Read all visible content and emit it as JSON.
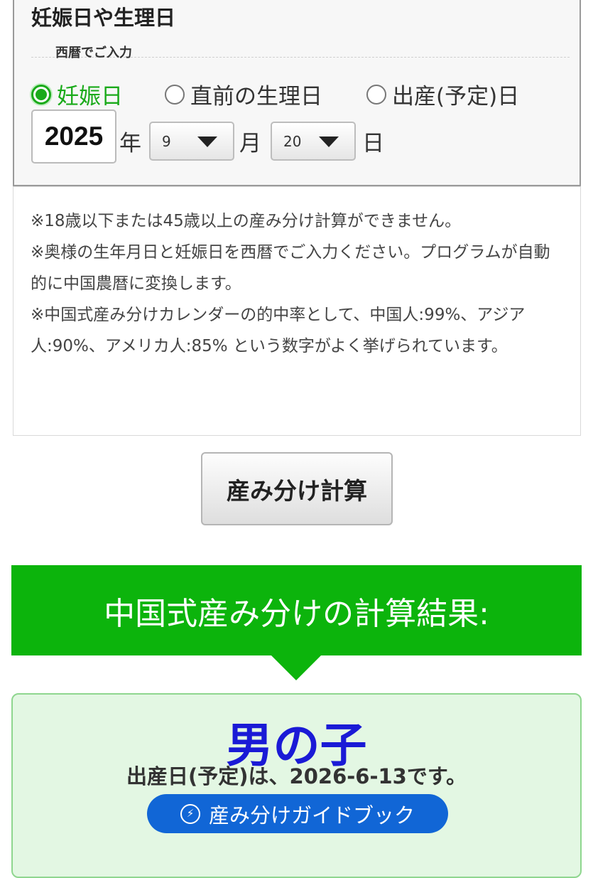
{
  "date_panel": {
    "title": "妊娠日や生理日",
    "era_label": "西暦でご入力",
    "radios": [
      {
        "label": "妊娠日",
        "checked": true
      },
      {
        "label": "直前の生理日",
        "checked": false
      },
      {
        "label": "出産(予定)日",
        "checked": false
      }
    ],
    "year_value": "2025",
    "year_unit": "年",
    "month_value": "9",
    "month_unit": "月",
    "day_value": "20",
    "day_unit": "日"
  },
  "notes": [
    "※18歳以下または45歳以上の産み分け計算ができません。",
    "※奥様の生年月日と妊娠日を西暦でご入力ください。プログラムが自動的に中国農暦に変換します。",
    "※中国式産み分けカレンダーの的中率として、中国人:99%、アジア人:90%、アメリカ人:85% という数字がよく挙げられています。"
  ],
  "calc_button_label": "産み分け計算",
  "result": {
    "header": "中国式産み分けの計算結果:",
    "gender": "男の子",
    "due_date_text": "出産日(予定)は、2026-6-13です。",
    "guide_button_label": "産み分けガイドブック",
    "guide_icon": "⚡"
  },
  "colors": {
    "accent_green": "#0cb40c",
    "result_background": "#e3f7e3",
    "gender_blue": "#1a1ad6",
    "guide_blue": "#1166d6"
  }
}
